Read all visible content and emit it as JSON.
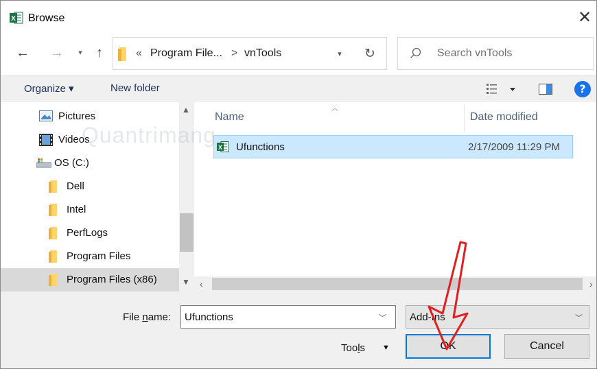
{
  "window": {
    "title": "Browse"
  },
  "address": {
    "crumbs": [
      "«",
      "Program File...",
      ">",
      "vnTools"
    ],
    "search_placeholder": "Search vnTools"
  },
  "toolbar": {
    "organize": "Organize ▾",
    "new_folder": "New folder",
    "help": "?"
  },
  "nav": {
    "items": [
      {
        "label": "Pictures"
      },
      {
        "label": "Videos"
      },
      {
        "label": "OS (C:)"
      },
      {
        "label": "Dell"
      },
      {
        "label": "Intel"
      },
      {
        "label": "PerfLogs"
      },
      {
        "label": "Program Files"
      },
      {
        "label": "Program Files (x86)"
      }
    ]
  },
  "filelist": {
    "columns": {
      "name": "Name",
      "date": "Date modified"
    },
    "rows": [
      {
        "name": "Ufunctions",
        "date": "2/17/2009 11:29 PM"
      }
    ]
  },
  "footer": {
    "file_name_label_pre": "File ",
    "file_name_label_u": "n",
    "file_name_label_post": "ame:",
    "file_name_value": "Ufunctions",
    "filter_value": "Add-Ins",
    "tools_pre": "Too",
    "tools_u": "l",
    "tools_post": "s",
    "ok": "OK",
    "cancel": "Cancel"
  },
  "watermark": "Quantrimang",
  "colors": {
    "accent": "#0078d7",
    "selection": "#cce8ff",
    "annotation_arrow": "#e02020"
  }
}
